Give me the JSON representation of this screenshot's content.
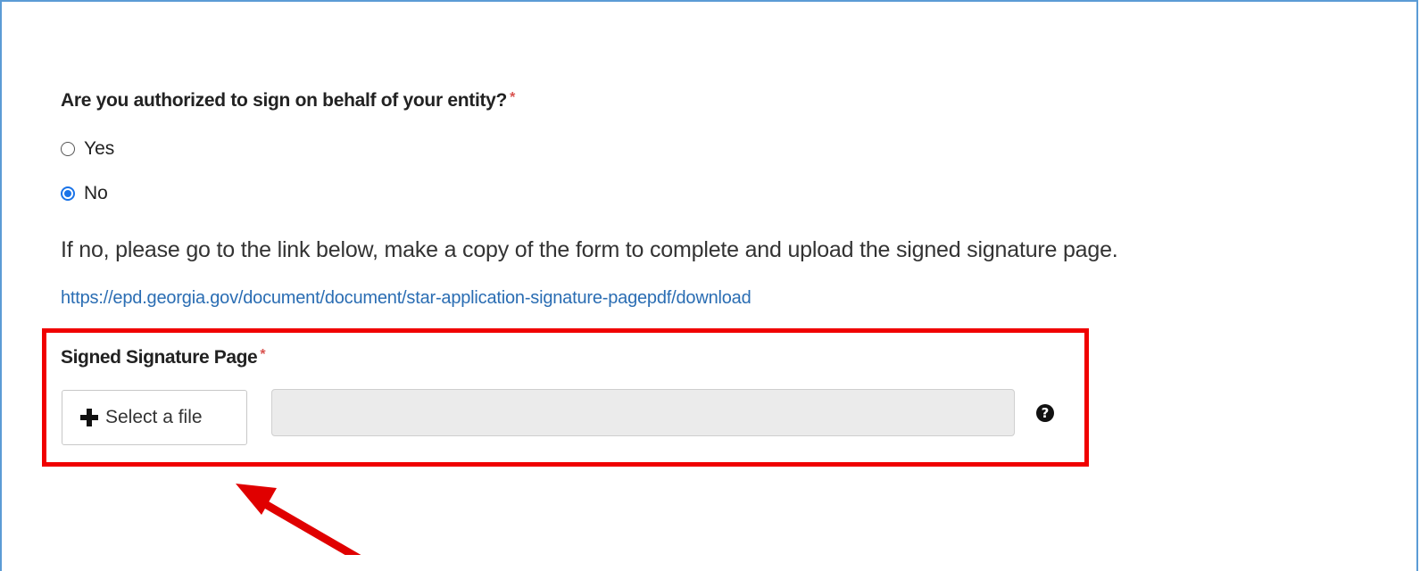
{
  "form": {
    "question": "Are you authorized to sign on behalf of your entity?",
    "required_marker": "*",
    "options": [
      {
        "label": "Yes",
        "checked": false
      },
      {
        "label": "No",
        "checked": true
      }
    ],
    "instruction": "If no, please go to the link below, make a copy of the form to complete and upload the signed signature page.",
    "link_text": "https://epd.georgia.gov/document/document/star-application-signature-pagepdf/download",
    "upload": {
      "label": "Signed Signature Page",
      "required_marker": "*",
      "button_label": "Select a file",
      "button_icon": "plus-icon",
      "file_name_value": "",
      "help_icon": "question-circle-icon",
      "help_glyph": "?"
    }
  },
  "annotation": {
    "highlight_color": "#f00000",
    "arrow_color": "#e00000"
  },
  "colors": {
    "frame_border": "#5b9bd5",
    "radio_checked": "#1a73e8",
    "link": "#2a6db3",
    "required": "#d9534f"
  }
}
